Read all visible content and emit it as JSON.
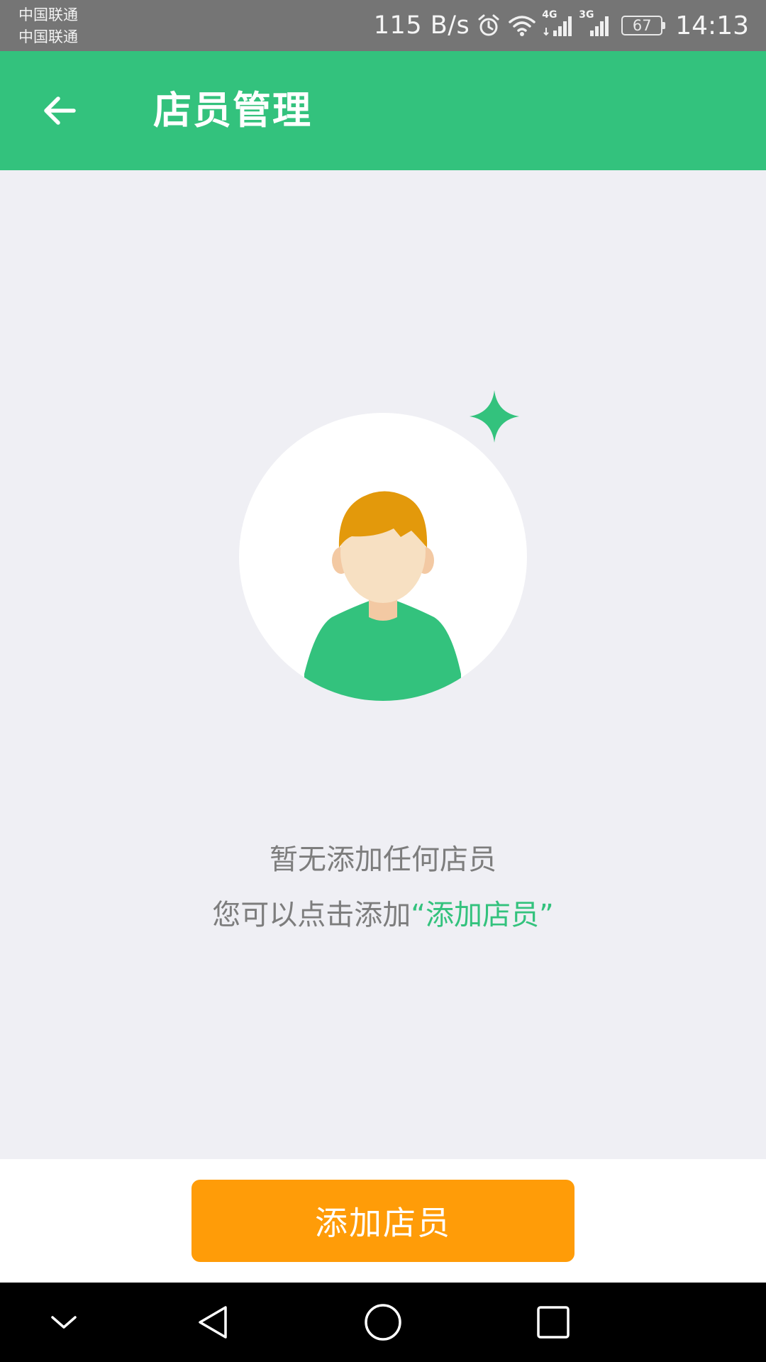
{
  "status_bar": {
    "carrier_1": "中国联通",
    "carrier_2": "中国联通",
    "net_speed": "115 B/s",
    "network_1": "4G",
    "network_2": "3G",
    "battery_level": "67",
    "time": "14:13",
    "icons": [
      "alarm-icon",
      "wifi-icon",
      "signal-4g-icon",
      "signal-3g-icon",
      "battery-icon"
    ]
  },
  "header": {
    "title": "店员管理",
    "back_icon": "arrow-left-icon",
    "background_color": "#33c27d"
  },
  "empty_state": {
    "illustration": "person-avatar-illustration",
    "title": "暂无添加任何店员",
    "hint_prefix": "您可以点击添加",
    "hint_highlight": "“添加店员”",
    "highlight_color": "#33c27d"
  },
  "actions": {
    "add_button_label": "添加店员",
    "add_button_color": "#ff9c08"
  },
  "nav_bar": {
    "icons": [
      "chevron-down-icon",
      "back-triangle-icon",
      "home-circle-icon",
      "recents-square-icon"
    ]
  }
}
